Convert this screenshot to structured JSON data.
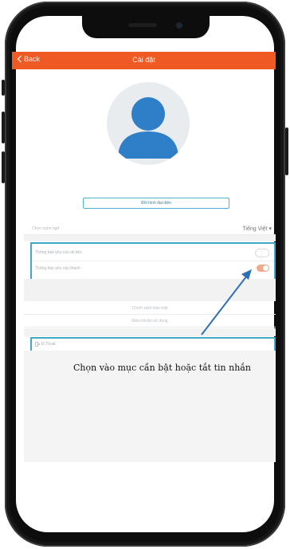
{
  "navbar": {
    "back_label": "Back",
    "title": "Cài đặt",
    "color": "#ef5a24"
  },
  "profile": {
    "change_avatar_label": "Đổi hình đại diện"
  },
  "language": {
    "label": "Chọn ngôn ngữ",
    "value": "Tiếng Việt",
    "dropdown_icon": "caret-down-icon"
  },
  "notifications": {
    "items": [
      {
        "label": "Thông báo yêu cầu tài liệu",
        "enabled": false
      },
      {
        "label": "Thông báo yêu cầu thanh",
        "enabled": true
      }
    ]
  },
  "links": [
    {
      "label": "Chính sách bảo mật"
    },
    {
      "label": "Điều khoản sử dụng"
    }
  ],
  "logout": {
    "label": "Đ.Thoát",
    "icon": "logout-icon"
  },
  "annotation": {
    "caption": "Chọn vào mục cần bật hoặc tắt tin nhắn",
    "highlight_color": "#3fa9c6",
    "arrow_color": "#2f6fb3"
  }
}
